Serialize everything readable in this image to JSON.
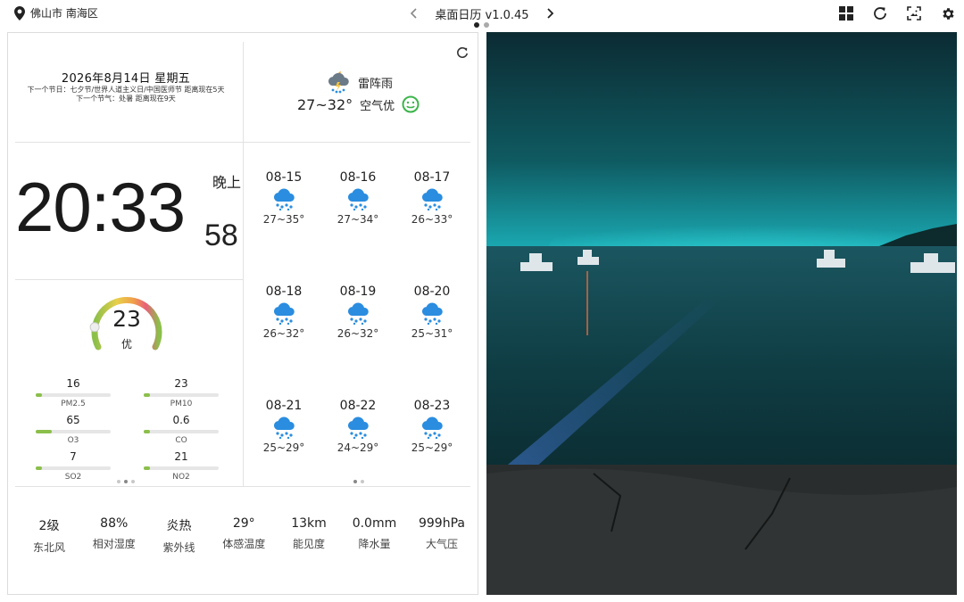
{
  "location": "佛山市 南海区",
  "app_title": "桌面日历 v1.0.45",
  "date": {
    "main": "2026年8月14日  星期五",
    "next_festival": "下一个节日：七夕节/世界人道主义日/中国医师节   距离现在5天",
    "next_solar_term": "下一个节气：处暑    距离现在9天"
  },
  "weather_now": {
    "condition": "雷阵雨",
    "temp_range": "27~32°",
    "air_quality": "空气优"
  },
  "clock": {
    "time": "20:33",
    "period": "晚上",
    "seconds": "58"
  },
  "aqi": {
    "value": "23",
    "level": "优",
    "fraction": 0.15,
    "pollutants": [
      {
        "value": "16",
        "name": "PM2.5",
        "fraction": 0.08
      },
      {
        "value": "23",
        "name": "PM10",
        "fraction": 0.08
      },
      {
        "value": "65",
        "name": "O3",
        "fraction": 0.22
      },
      {
        "value": "0.6",
        "name": "CO",
        "fraction": 0.08
      },
      {
        "value": "7",
        "name": "SO2",
        "fraction": 0.08
      },
      {
        "value": "21",
        "name": "NO2",
        "fraction": 0.08
      }
    ]
  },
  "forecast": [
    {
      "date": "08-15",
      "range": "27~35°"
    },
    {
      "date": "08-16",
      "range": "27~34°"
    },
    {
      "date": "08-17",
      "range": "26~33°"
    },
    {
      "date": "08-18",
      "range": "26~32°"
    },
    {
      "date": "08-19",
      "range": "26~32°"
    },
    {
      "date": "08-20",
      "range": "25~31°"
    },
    {
      "date": "08-21",
      "range": "25~29°"
    },
    {
      "date": "08-22",
      "range": "24~29°"
    },
    {
      "date": "08-23",
      "range": "25~29°"
    }
  ],
  "stats": [
    {
      "value": "2级",
      "label": "东北风"
    },
    {
      "value": "88%",
      "label": "相对湿度"
    },
    {
      "value": "炎热",
      "label": "紫外线"
    },
    {
      "value": "29°",
      "label": "体感温度"
    },
    {
      "value": "13km",
      "label": "能见度"
    },
    {
      "value": "0.0mm",
      "label": "降水量"
    },
    {
      "value": "999hPa",
      "label": "大气压"
    }
  ],
  "colors": {
    "rain_icon": "#2a8de0",
    "smile": "#3bb54a",
    "bar_fill": "#8bbf4a",
    "sea": "#0e3d40"
  }
}
